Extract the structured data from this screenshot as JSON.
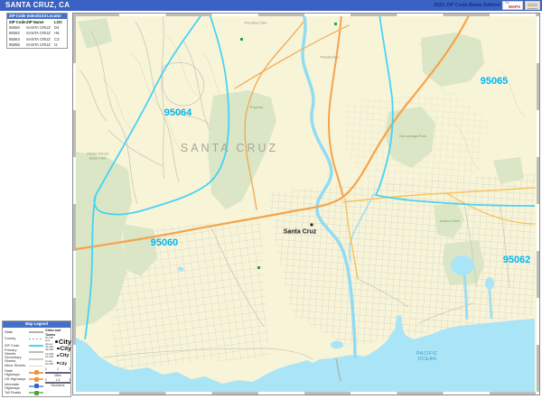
{
  "header": {
    "title": "SANTA CRUZ, CA",
    "edition": "2023 ZIP Code Basic Edition",
    "logo_text": "MAPS"
  },
  "zip_index": {
    "title": "ZIP Code Index/Grid Locator",
    "columns": {
      "code": "ZIP Code",
      "name": "ZIP Name",
      "loc": "LOC"
    },
    "rows": [
      {
        "code": "95060",
        "name": "SANTA CRUZ",
        "loc": "D4"
      },
      {
        "code": "95062",
        "name": "SANTA CRUZ",
        "loc": "H5"
      },
      {
        "code": "95064",
        "name": "SANTA CRUZ",
        "loc": "C3"
      },
      {
        "code": "95065",
        "name": "SANTA CRUZ",
        "loc": "I2"
      }
    ]
  },
  "map": {
    "area_label": "SANTA CRUZ",
    "city_label": "Santa Cruz",
    "ocean_label_line1": "PACIFIC",
    "ocean_label_line2": "OCEAN",
    "zips": {
      "z95064": "95064",
      "z95065": "95065",
      "z95060": "95060",
      "z95062": "95062"
    },
    "places": {
      "paradise_park": "Paradise Park",
      "pasatiempo": "Pasatiempo"
    },
    "parks": {
      "pogonip": "Pogonip",
      "wilder": "Wilder Ranch State Park",
      "delaveaga": "DeLaveaga Park",
      "arana": "Arana Gulch"
    }
  },
  "legend": {
    "title": "Map Legend",
    "line_items": [
      {
        "label": "State"
      },
      {
        "label": "County"
      },
      {
        "label": "ZIP Code"
      },
      {
        "label": "Primary Streets"
      },
      {
        "label": "Secondary Streets"
      },
      {
        "label": "Minor Streets"
      },
      {
        "label": "State Highways"
      },
      {
        "label": "US Highways"
      },
      {
        "label": "Interstate Highways"
      },
      {
        "label": "Toll Roads"
      }
    ],
    "cities_title": "Cities and Towns",
    "city_classes": [
      {
        "range": "50,000 and above",
        "sample": "City"
      },
      {
        "range": "25,000 - 49,999",
        "sample": "City"
      },
      {
        "range": "10,000 - 24,999",
        "sample": "City"
      },
      {
        "range": "Under 10,000",
        "sample": "City"
      }
    ],
    "scale": {
      "miles": {
        "label": "Miles",
        "ticks": [
          "0",
          "1",
          "2"
        ]
      },
      "kilometers": {
        "label": "Kilometers",
        "ticks": [
          "0",
          "1.5",
          "3"
        ]
      }
    }
  },
  "colors": {
    "header_bar": "#3a62c2",
    "table_header": "#4470c8",
    "zip_boundary": "#3ed2f6",
    "zip_label": "#00b6f2",
    "water": "#aae5f7",
    "land": "#f8f4d8",
    "park_green": "#dbe6c6",
    "highway_orange": "#f4a44c"
  }
}
